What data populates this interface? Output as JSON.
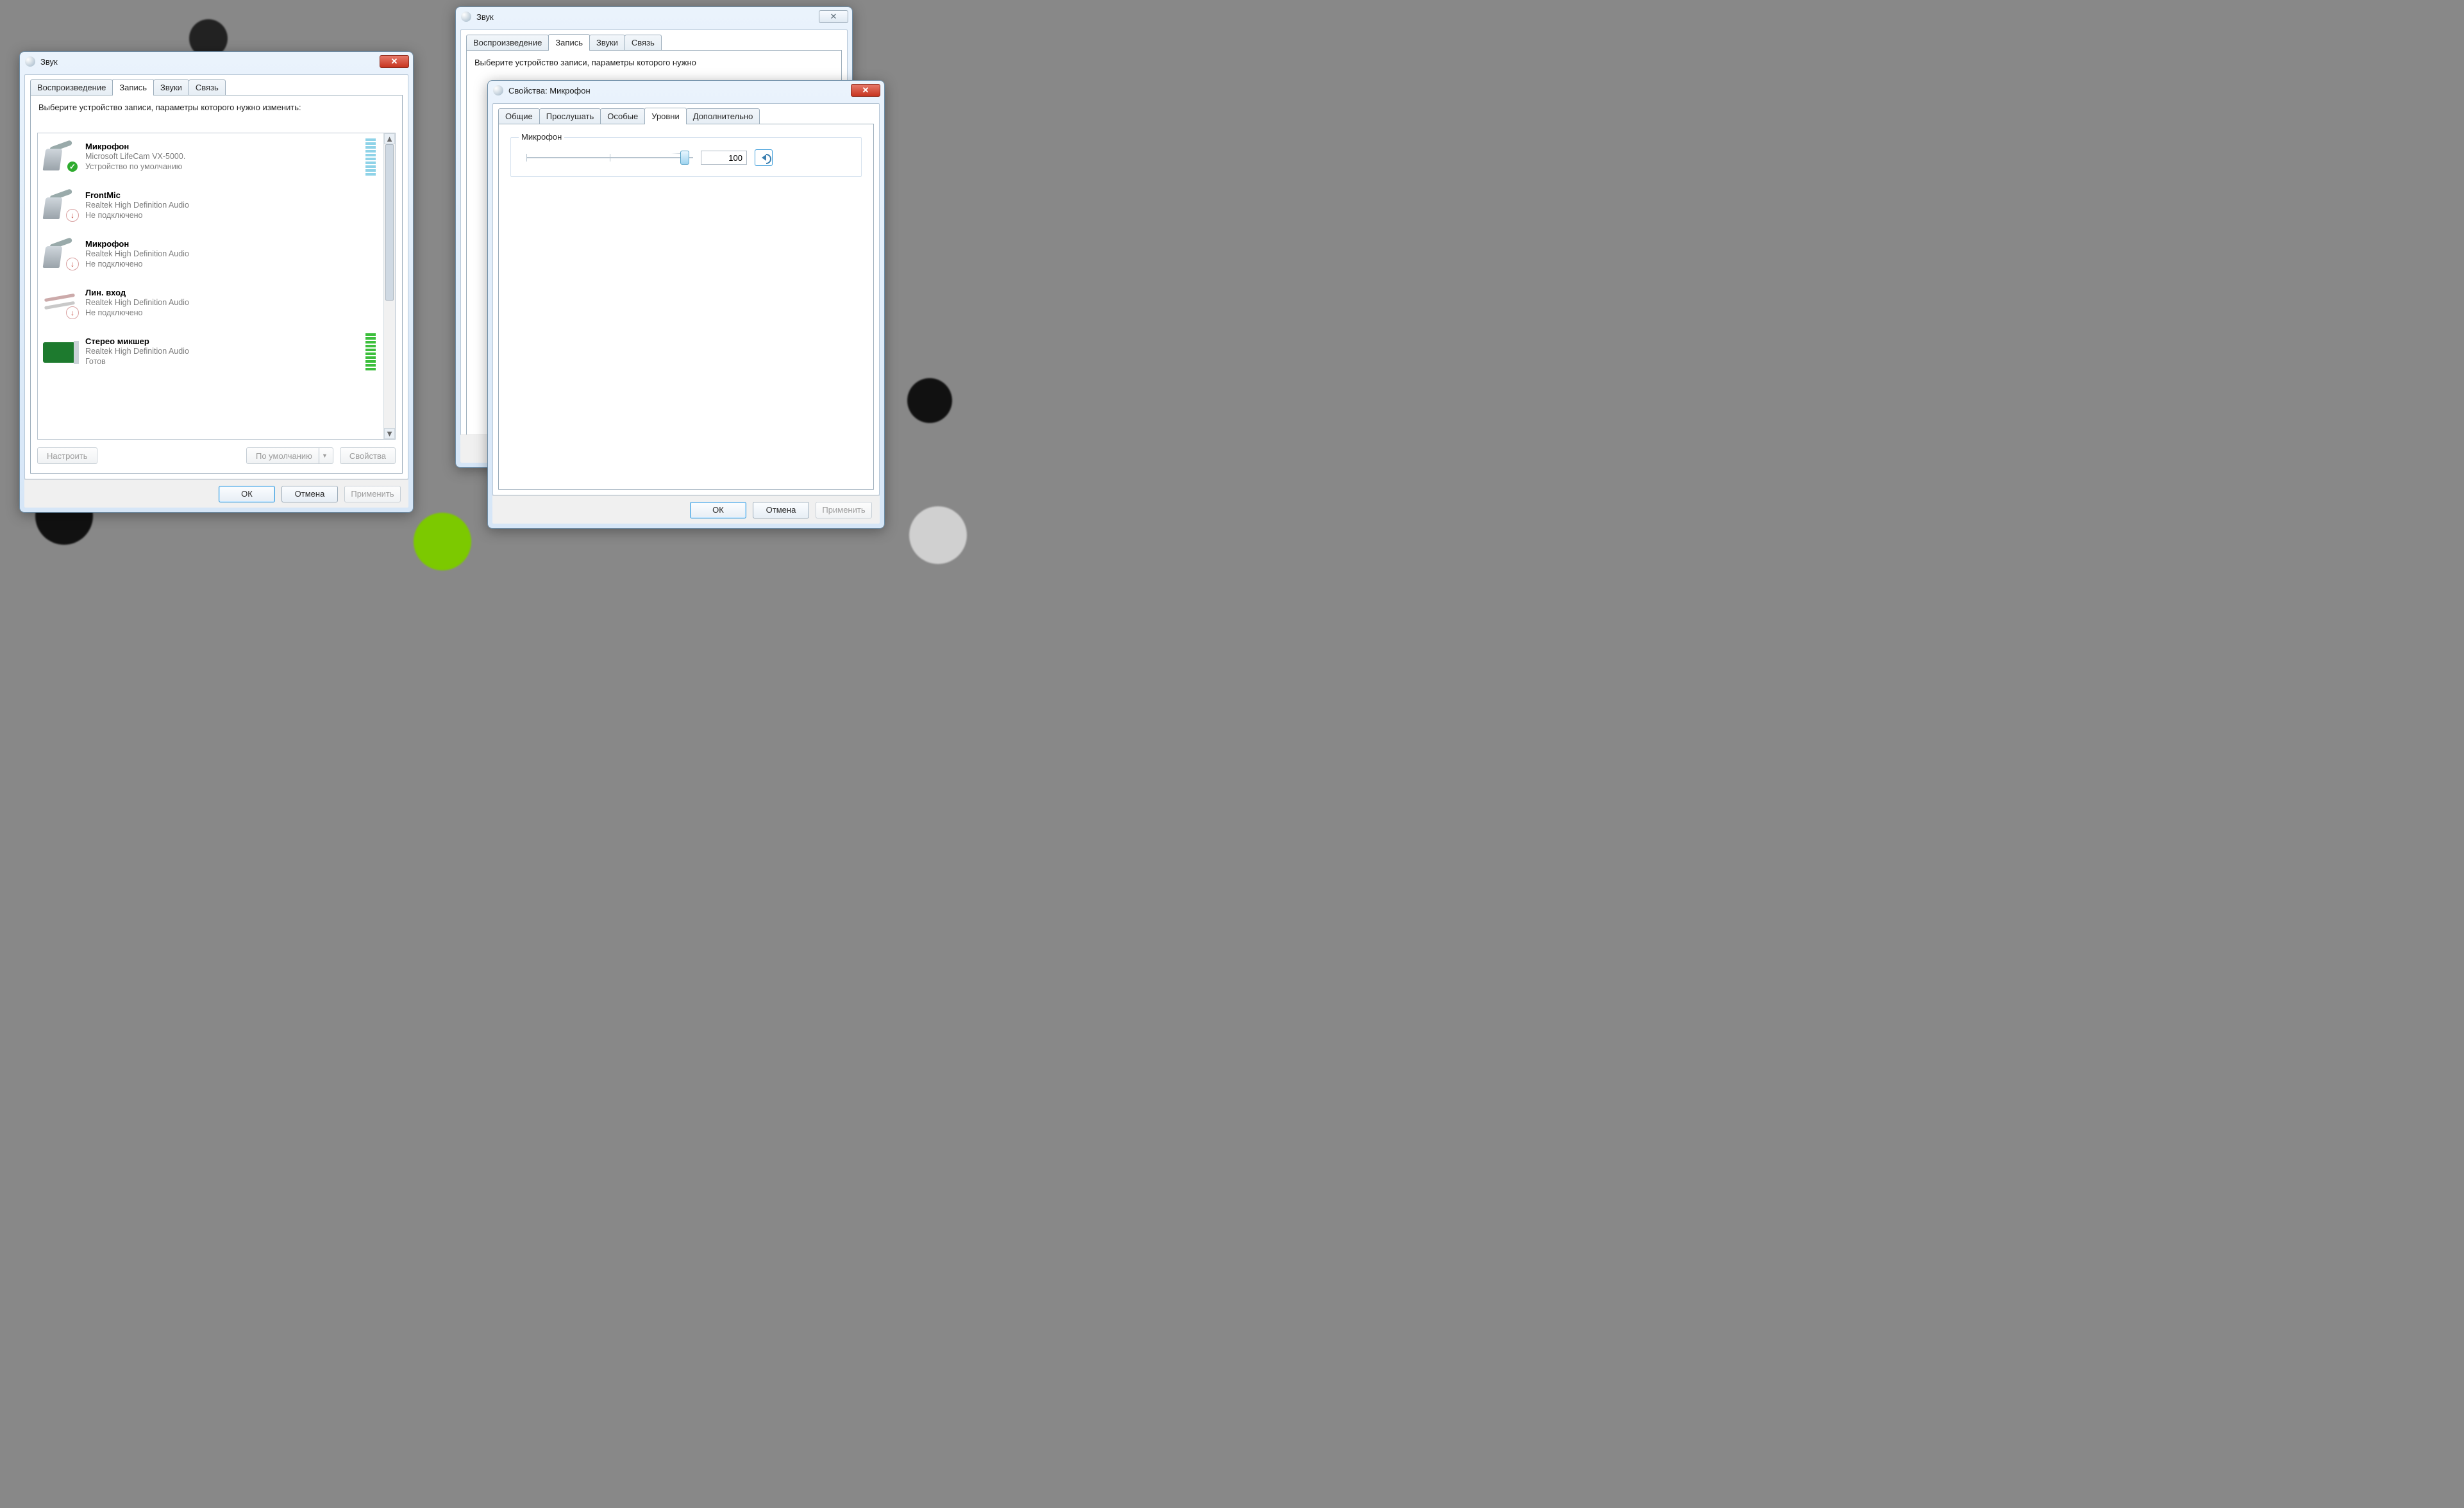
{
  "sound_dialog": {
    "title": "Звук",
    "tabs": {
      "playback": "Воспроизведение",
      "recording": "Запись",
      "sounds": "Звуки",
      "communications": "Связь"
    },
    "instructions": "Выберите устройство записи, параметры которого нужно изменить:",
    "devices": [
      {
        "name": "Микрофон",
        "driver": "Microsoft LifeCam VX-5000.",
        "status": "Устройство по умолчанию",
        "icon": "mic",
        "badge": "ok",
        "level_style": "blue"
      },
      {
        "name": "FrontMic",
        "driver": "Realtek High Definition Audio",
        "status": "Не подключено",
        "icon": "mic",
        "badge": "down",
        "level_style": "none"
      },
      {
        "name": "Микрофон",
        "driver": "Realtek High Definition Audio",
        "status": "Не подключено",
        "icon": "mic",
        "badge": "down",
        "level_style": "none"
      },
      {
        "name": "Лин. вход",
        "driver": "Realtek High Definition Audio",
        "status": "Не подключено",
        "icon": "linein",
        "badge": "down",
        "level_style": "none"
      },
      {
        "name": "Стерео микшер",
        "driver": "Realtek High Definition Audio",
        "status": "Готов",
        "icon": "card",
        "badge": "none",
        "level_style": "green"
      }
    ],
    "buttons": {
      "configure": "Настроить",
      "set_default": "По умолчанию",
      "properties": "Свойства",
      "ok": "ОК",
      "cancel": "Отмена",
      "apply": "Применить"
    }
  },
  "sound_dialog_right": {
    "instructions_line1": "Выберите устройство записи, параметры которого нужно"
  },
  "properties_dialog": {
    "title": "Свойства: Микрофон",
    "tabs": {
      "general": "Общие",
      "listen": "Прослушать",
      "custom": "Особые",
      "levels": "Уровни",
      "advanced": "Дополнительно"
    },
    "levels_group": {
      "legend": "Микрофон",
      "value": "100"
    },
    "buttons": {
      "ok": "ОК",
      "cancel": "Отмена",
      "apply": "Применить"
    }
  },
  "glyphs": {
    "close_x": "✕",
    "caret": "▼",
    "up": "▲",
    "down": "▼",
    "check": "✓"
  }
}
